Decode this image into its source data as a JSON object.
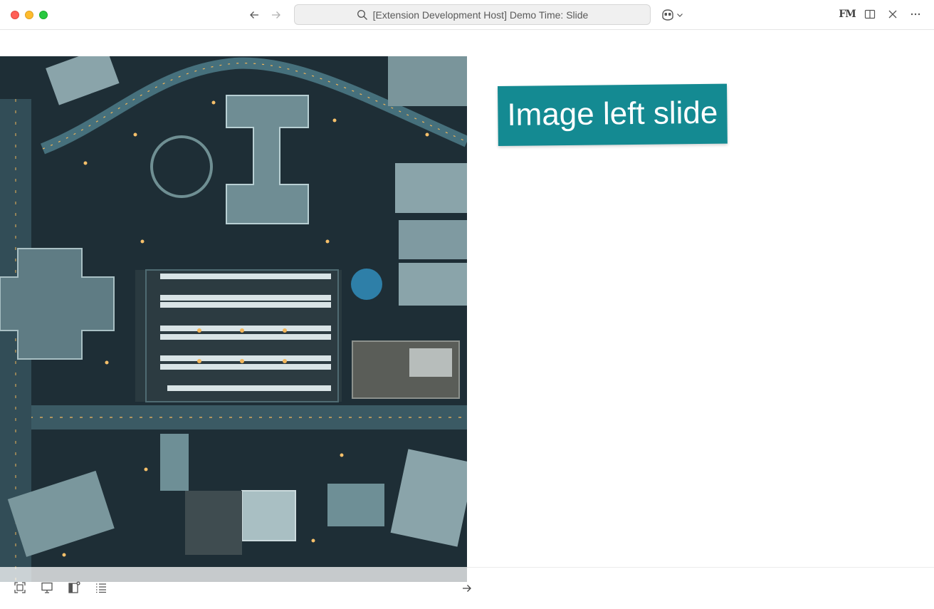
{
  "window": {
    "title": "[Extension Development Host] Demo Time: Slide",
    "traffic_colors": {
      "close": "#ff5f57",
      "minimize": "#febc2e",
      "maximize": "#28c840"
    }
  },
  "header": {
    "icons": [
      "back-arrow-icon",
      "forward-arrow-icon",
      "search-icon",
      "copilot-icon",
      "front-matter-icon",
      "split-editor-icon",
      "close-icon",
      "more-actions-icon"
    ],
    "front_matter_text": "FM"
  },
  "slide": {
    "layout": "image-left",
    "title": "Image left slide",
    "title_background": "#148a92",
    "image_description": "aerial night city view"
  },
  "footer": {
    "controls": [
      "fullscreen-icon",
      "presentation-icon",
      "panel-toggle-icon",
      "slides-list-icon"
    ],
    "next_icon": "next-arrow-icon"
  }
}
